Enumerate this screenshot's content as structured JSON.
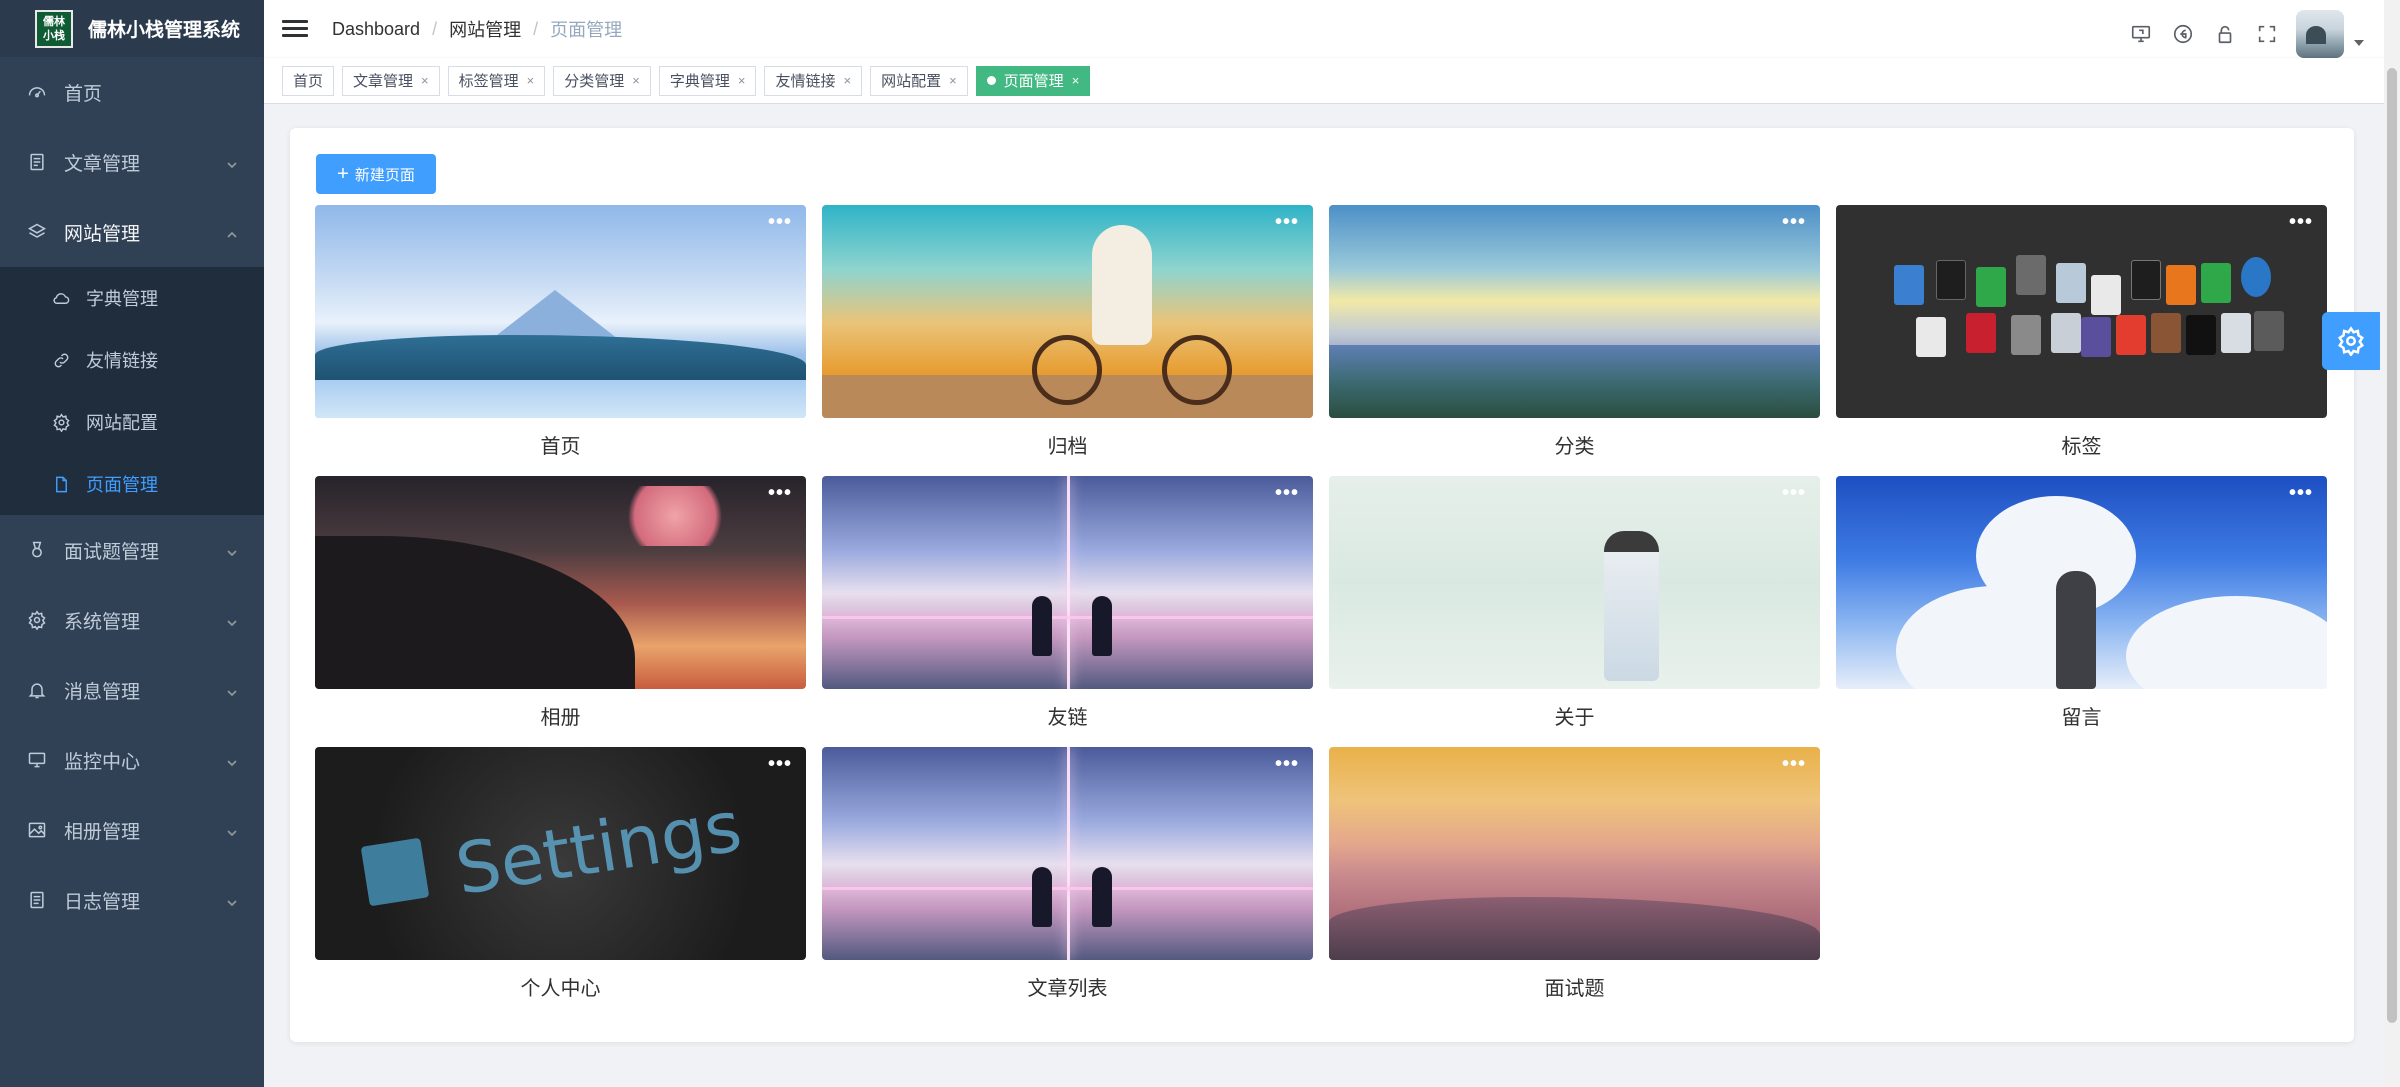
{
  "logo": {
    "box_text": "儒林小栈",
    "title": "儒林小栈管理系统"
  },
  "sidebar": {
    "items": [
      {
        "label": "首页",
        "icon": "dashboard-icon"
      },
      {
        "label": "文章管理",
        "icon": "document-icon"
      },
      {
        "label": "网站管理",
        "icon": "layers-icon"
      },
      {
        "label": "面试题管理",
        "icon": "medal-icon"
      },
      {
        "label": "系统管理",
        "icon": "gear-icon"
      },
      {
        "label": "消息管理",
        "icon": "bell-icon"
      },
      {
        "label": "监控中心",
        "icon": "monitor-icon"
      },
      {
        "label": "相册管理",
        "icon": "image-icon"
      },
      {
        "label": "日志管理",
        "icon": "log-icon"
      }
    ],
    "website_sub": [
      {
        "label": "字典管理",
        "icon": "cloud-icon"
      },
      {
        "label": "友情链接",
        "icon": "link-icon"
      },
      {
        "label": "网站配置",
        "icon": "gear-icon"
      },
      {
        "label": "页面管理",
        "icon": "page-icon"
      }
    ]
  },
  "breadcrumb": [
    "Dashboard",
    "网站管理",
    "页面管理"
  ],
  "tags": [
    {
      "label": "首页",
      "closable": false
    },
    {
      "label": "文章管理",
      "closable": true
    },
    {
      "label": "标签管理",
      "closable": true
    },
    {
      "label": "分类管理",
      "closable": true
    },
    {
      "label": "字典管理",
      "closable": true
    },
    {
      "label": "友情链接",
      "closable": true
    },
    {
      "label": "网站配置",
      "closable": true
    },
    {
      "label": "页面管理",
      "closable": true,
      "active": true
    }
  ],
  "tag_close_glyph": "×",
  "new_button": {
    "plus": "+",
    "label": "新建页面"
  },
  "more_glyph": "•••",
  "pages": [
    {
      "name": "首页"
    },
    {
      "name": "归档"
    },
    {
      "name": "分类"
    },
    {
      "name": "标签"
    },
    {
      "name": "相册"
    },
    {
      "name": "友链"
    },
    {
      "name": "关于"
    },
    {
      "name": "留言"
    },
    {
      "name": "个人中心"
    },
    {
      "name": "文章列表"
    },
    {
      "name": "面试题"
    }
  ],
  "settings_cover_text": "Settings",
  "colors": {
    "sidebar_bg": "#304156",
    "active_menu": "#409eff",
    "active_tag": "#42b983",
    "primary": "#409eff"
  }
}
